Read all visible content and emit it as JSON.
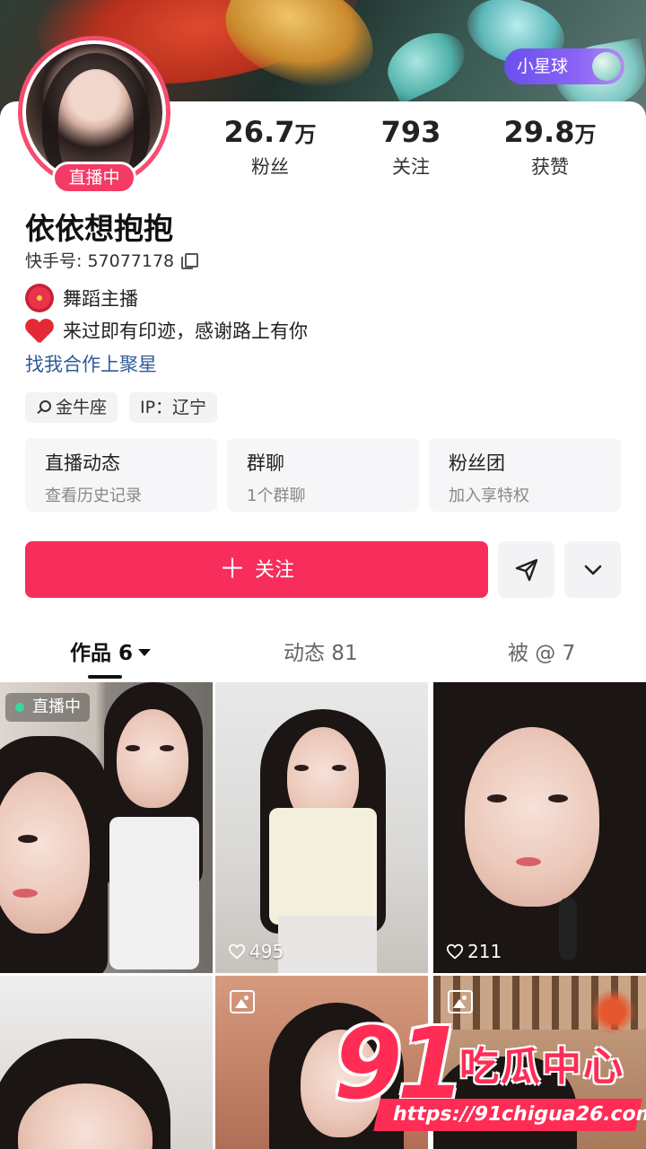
{
  "header": {
    "star_badge_label": "小星球"
  },
  "profile": {
    "live_status": "直播中",
    "name": "依依想抱抱",
    "account_label": "快手号: 57077178",
    "bio": [
      "舞蹈主播",
      "来过即有印迹，感谢路上有你"
    ],
    "cooperation_link": "找我合作上聚星",
    "tags": [
      "金牛座",
      "IP：辽宁"
    ]
  },
  "stats": [
    {
      "value": "26.7",
      "unit": "万",
      "label": "粉丝"
    },
    {
      "value": "793",
      "unit": "",
      "label": "关注"
    },
    {
      "value": "29.8",
      "unit": "万",
      "label": "获赞"
    }
  ],
  "cards": [
    {
      "title": "直播动态",
      "subtitle": "查看历史记录"
    },
    {
      "title": "群聊",
      "subtitle": "1个群聊"
    },
    {
      "title": "粉丝团",
      "subtitle": "加入享特权"
    }
  ],
  "actions": {
    "follow_label": "关注",
    "plus": "＋"
  },
  "tabs": [
    {
      "label": "作品 6",
      "active": true
    },
    {
      "label": "动态 81",
      "active": false
    },
    {
      "label": "被 @ 7",
      "active": false
    }
  ],
  "grid": [
    {
      "type": "live",
      "badge": "直播中"
    },
    {
      "type": "video",
      "likes": "495"
    },
    {
      "type": "video",
      "likes": "211"
    },
    {
      "type": "video"
    },
    {
      "type": "gallery"
    },
    {
      "type": "gallery"
    }
  ],
  "watermark": {
    "number": "91",
    "brand": "吃瓜中心",
    "url": "https://91chigua26.com"
  },
  "colors": {
    "accent": "#f72d5c",
    "link": "#2f5b9a",
    "live_dot": "#35d9a4"
  }
}
